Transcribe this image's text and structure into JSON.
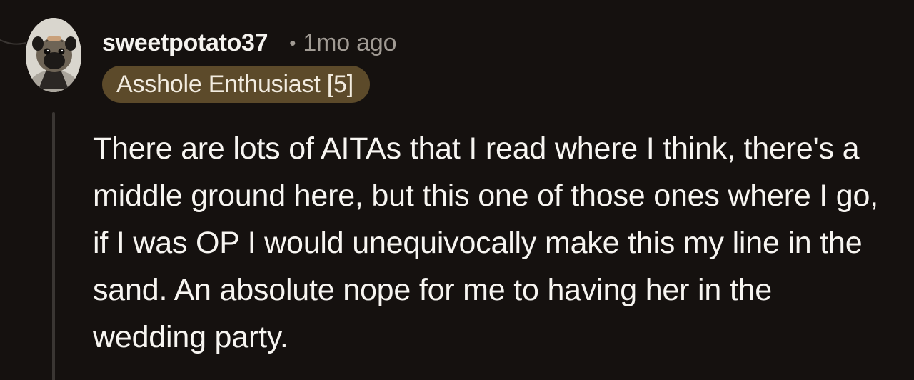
{
  "comment": {
    "username": "sweetpotato37",
    "separator": "•",
    "timestamp": "1mo ago",
    "flair": "Asshole Enthusiast [5]",
    "body": "There are lots of AITAs that I read where I think, there's a middle ground here, but this one of those ones where I go, if I was OP I would unequivocally make this my line in the sand. An absolute nope for me to having her in the wedding party."
  },
  "colors": {
    "background": "#15110f",
    "flair_background": "#5c4a2a",
    "muted_text": "#a19b94",
    "thread_line": "#3a3633"
  },
  "icons": {
    "avatar": "pug-avatar"
  }
}
